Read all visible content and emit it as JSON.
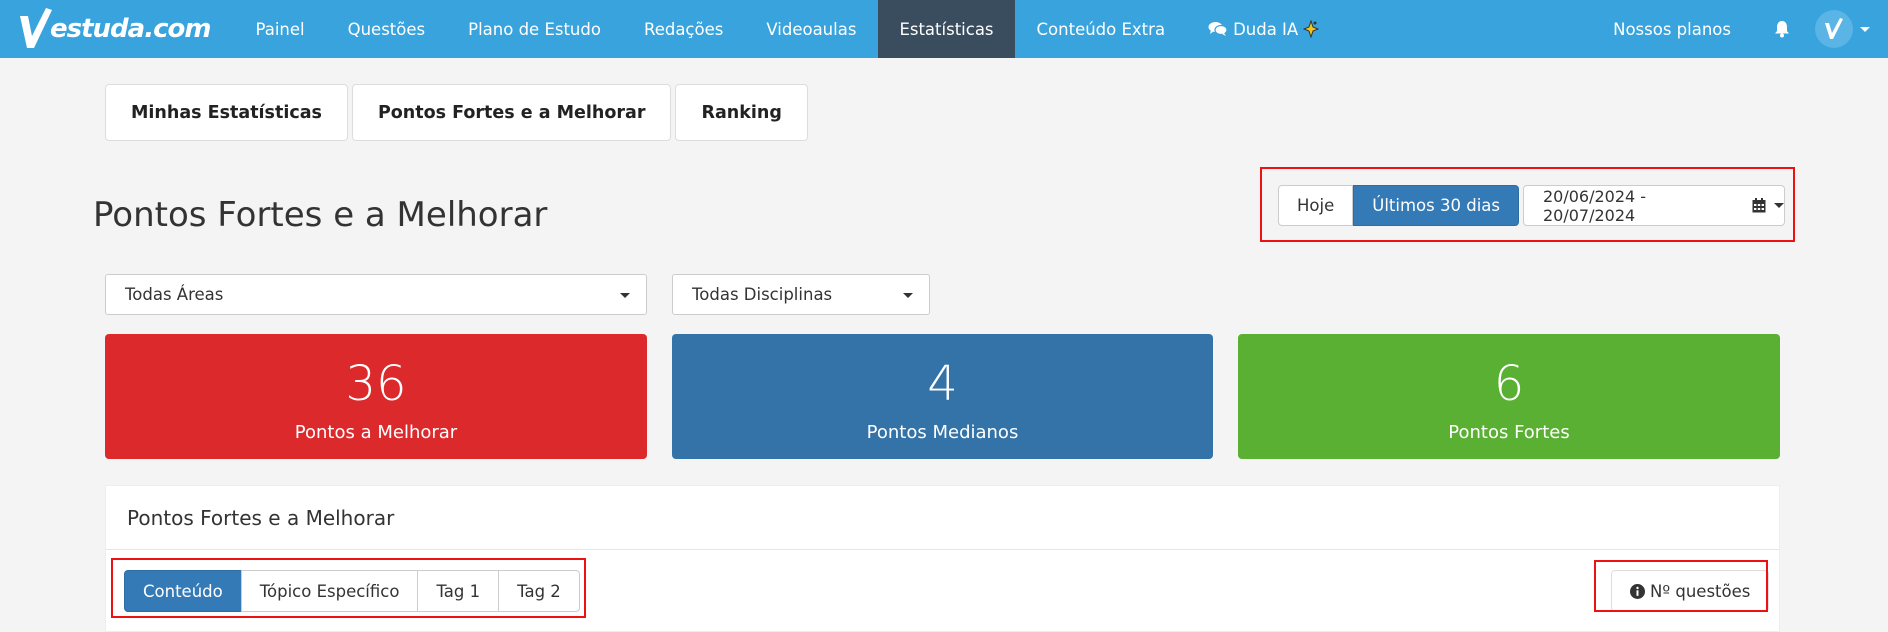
{
  "brand": {
    "name": "estuda.com"
  },
  "nav": {
    "items": [
      {
        "label": "Painel"
      },
      {
        "label": "Questões"
      },
      {
        "label": "Plano de Estudo"
      },
      {
        "label": "Redações"
      },
      {
        "label": "Videoaulas"
      },
      {
        "label": "Estatísticas",
        "active": true
      },
      {
        "label": "Conteúdo Extra"
      },
      {
        "label": "Duda IA",
        "icon": "chat-icon",
        "badge_icon": "sparkle-icon"
      }
    ],
    "plans_label": "Nossos planos",
    "bell_icon": "bell-icon",
    "avatar_icon": "checkmark-avatar"
  },
  "tabs": [
    "Minhas Estatísticas",
    "Pontos Fortes e a Melhorar",
    "Ranking"
  ],
  "page_title": "Pontos Fortes e a Melhorar",
  "date_filter": {
    "today_label": "Hoje",
    "last30_label": "Últimos 30 dias",
    "range": "20/06/2024 - 20/07/2024",
    "calendar_icon": "calendar-icon"
  },
  "filters": {
    "area": "Todas Áreas",
    "discipline": "Todas Disciplinas"
  },
  "stats": [
    {
      "value": "36",
      "label": "Pontos a Melhorar",
      "color": "#dc292b"
    },
    {
      "value": "4",
      "label": "Pontos Medianos",
      "color": "#3473a8"
    },
    {
      "value": "6",
      "label": "Pontos Fortes",
      "color": "#5ab032"
    }
  ],
  "panel": {
    "title": "Pontos Fortes e a Melhorar",
    "segments": [
      "Conteúdo",
      "Tópico Específico",
      "Tag 1",
      "Tag 2"
    ],
    "questions_label": "Nº questões"
  },
  "colors": {
    "navbar": "#38a3dc",
    "nav_active": "#3a4d5e",
    "primary": "#337ab7",
    "highlight": "#ee1111"
  }
}
